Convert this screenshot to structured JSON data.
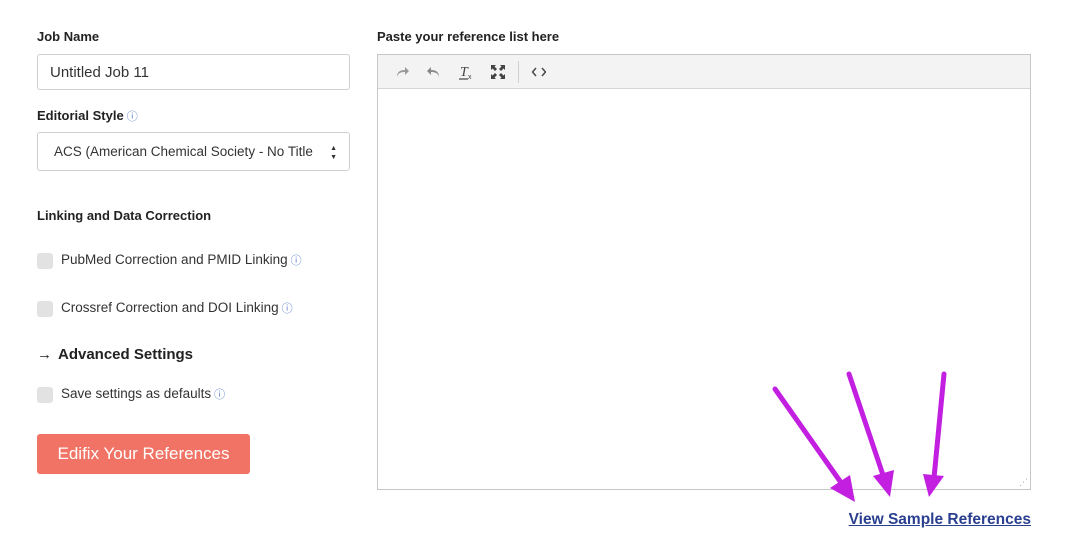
{
  "form": {
    "job_name_label": "Job Name",
    "job_name_value": "Untitled Job 11",
    "editorial_style_label": "Editorial Style",
    "editorial_style_value": "ACS (American Chemical Society - No Title",
    "info_glyph": "ⓘ",
    "linking_label": "Linking and Data Correction",
    "pubmed_label": "PubMed Correction and PMID Linking",
    "crossref_label": "Crossref Correction and DOI Linking",
    "advanced_arrow": "→",
    "advanced_label": "Advanced Settings",
    "save_defaults_label": "Save settings as defaults",
    "submit_label": "Edifix Your References"
  },
  "editor": {
    "label": "Paste your reference list here",
    "toolbar": [
      "redo-icon",
      "undo-icon",
      "clear-format-icon",
      "fullscreen-icon",
      "code-icon"
    ]
  },
  "links": {
    "view_sample": "View Sample References"
  },
  "colors": {
    "button_bg": "#f07365",
    "link": "#2a3f8f",
    "annotation_arrow": "#c21fe0"
  }
}
